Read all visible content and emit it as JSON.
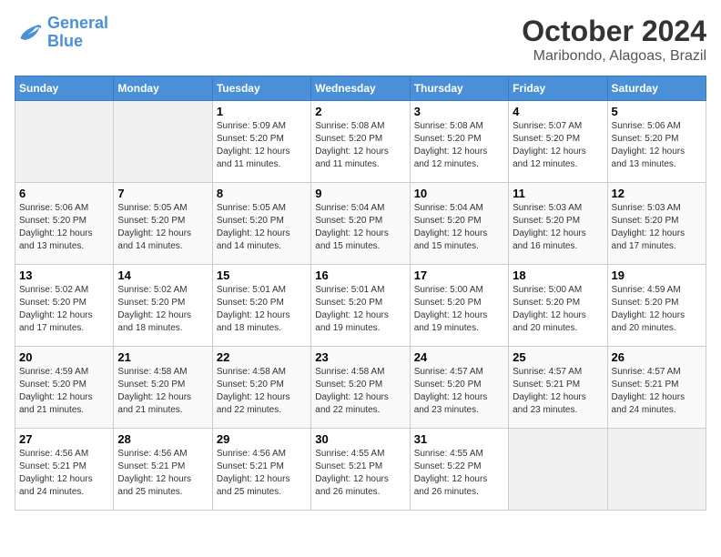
{
  "logo": {
    "line1": "General",
    "line2": "Blue"
  },
  "title": "October 2024",
  "subtitle": "Maribondo, Alagoas, Brazil",
  "headers": [
    "Sunday",
    "Monday",
    "Tuesday",
    "Wednesday",
    "Thursday",
    "Friday",
    "Saturday"
  ],
  "weeks": [
    [
      {
        "num": "",
        "sunrise": "",
        "sunset": "",
        "daylight": ""
      },
      {
        "num": "",
        "sunrise": "",
        "sunset": "",
        "daylight": ""
      },
      {
        "num": "1",
        "sunrise": "Sunrise: 5:09 AM",
        "sunset": "Sunset: 5:20 PM",
        "daylight": "Daylight: 12 hours and 11 minutes."
      },
      {
        "num": "2",
        "sunrise": "Sunrise: 5:08 AM",
        "sunset": "Sunset: 5:20 PM",
        "daylight": "Daylight: 12 hours and 11 minutes."
      },
      {
        "num": "3",
        "sunrise": "Sunrise: 5:08 AM",
        "sunset": "Sunset: 5:20 PM",
        "daylight": "Daylight: 12 hours and 12 minutes."
      },
      {
        "num": "4",
        "sunrise": "Sunrise: 5:07 AM",
        "sunset": "Sunset: 5:20 PM",
        "daylight": "Daylight: 12 hours and 12 minutes."
      },
      {
        "num": "5",
        "sunrise": "Sunrise: 5:06 AM",
        "sunset": "Sunset: 5:20 PM",
        "daylight": "Daylight: 12 hours and 13 minutes."
      }
    ],
    [
      {
        "num": "6",
        "sunrise": "Sunrise: 5:06 AM",
        "sunset": "Sunset: 5:20 PM",
        "daylight": "Daylight: 12 hours and 13 minutes."
      },
      {
        "num": "7",
        "sunrise": "Sunrise: 5:05 AM",
        "sunset": "Sunset: 5:20 PM",
        "daylight": "Daylight: 12 hours and 14 minutes."
      },
      {
        "num": "8",
        "sunrise": "Sunrise: 5:05 AM",
        "sunset": "Sunset: 5:20 PM",
        "daylight": "Daylight: 12 hours and 14 minutes."
      },
      {
        "num": "9",
        "sunrise": "Sunrise: 5:04 AM",
        "sunset": "Sunset: 5:20 PM",
        "daylight": "Daylight: 12 hours and 15 minutes."
      },
      {
        "num": "10",
        "sunrise": "Sunrise: 5:04 AM",
        "sunset": "Sunset: 5:20 PM",
        "daylight": "Daylight: 12 hours and 15 minutes."
      },
      {
        "num": "11",
        "sunrise": "Sunrise: 5:03 AM",
        "sunset": "Sunset: 5:20 PM",
        "daylight": "Daylight: 12 hours and 16 minutes."
      },
      {
        "num": "12",
        "sunrise": "Sunrise: 5:03 AM",
        "sunset": "Sunset: 5:20 PM",
        "daylight": "Daylight: 12 hours and 17 minutes."
      }
    ],
    [
      {
        "num": "13",
        "sunrise": "Sunrise: 5:02 AM",
        "sunset": "Sunset: 5:20 PM",
        "daylight": "Daylight: 12 hours and 17 minutes."
      },
      {
        "num": "14",
        "sunrise": "Sunrise: 5:02 AM",
        "sunset": "Sunset: 5:20 PM",
        "daylight": "Daylight: 12 hours and 18 minutes."
      },
      {
        "num": "15",
        "sunrise": "Sunrise: 5:01 AM",
        "sunset": "Sunset: 5:20 PM",
        "daylight": "Daylight: 12 hours and 18 minutes."
      },
      {
        "num": "16",
        "sunrise": "Sunrise: 5:01 AM",
        "sunset": "Sunset: 5:20 PM",
        "daylight": "Daylight: 12 hours and 19 minutes."
      },
      {
        "num": "17",
        "sunrise": "Sunrise: 5:00 AM",
        "sunset": "Sunset: 5:20 PM",
        "daylight": "Daylight: 12 hours and 19 minutes."
      },
      {
        "num": "18",
        "sunrise": "Sunrise: 5:00 AM",
        "sunset": "Sunset: 5:20 PM",
        "daylight": "Daylight: 12 hours and 20 minutes."
      },
      {
        "num": "19",
        "sunrise": "Sunrise: 4:59 AM",
        "sunset": "Sunset: 5:20 PM",
        "daylight": "Daylight: 12 hours and 20 minutes."
      }
    ],
    [
      {
        "num": "20",
        "sunrise": "Sunrise: 4:59 AM",
        "sunset": "Sunset: 5:20 PM",
        "daylight": "Daylight: 12 hours and 21 minutes."
      },
      {
        "num": "21",
        "sunrise": "Sunrise: 4:58 AM",
        "sunset": "Sunset: 5:20 PM",
        "daylight": "Daylight: 12 hours and 21 minutes."
      },
      {
        "num": "22",
        "sunrise": "Sunrise: 4:58 AM",
        "sunset": "Sunset: 5:20 PM",
        "daylight": "Daylight: 12 hours and 22 minutes."
      },
      {
        "num": "23",
        "sunrise": "Sunrise: 4:58 AM",
        "sunset": "Sunset: 5:20 PM",
        "daylight": "Daylight: 12 hours and 22 minutes."
      },
      {
        "num": "24",
        "sunrise": "Sunrise: 4:57 AM",
        "sunset": "Sunset: 5:20 PM",
        "daylight": "Daylight: 12 hours and 23 minutes."
      },
      {
        "num": "25",
        "sunrise": "Sunrise: 4:57 AM",
        "sunset": "Sunset: 5:21 PM",
        "daylight": "Daylight: 12 hours and 23 minutes."
      },
      {
        "num": "26",
        "sunrise": "Sunrise: 4:57 AM",
        "sunset": "Sunset: 5:21 PM",
        "daylight": "Daylight: 12 hours and 24 minutes."
      }
    ],
    [
      {
        "num": "27",
        "sunrise": "Sunrise: 4:56 AM",
        "sunset": "Sunset: 5:21 PM",
        "daylight": "Daylight: 12 hours and 24 minutes."
      },
      {
        "num": "28",
        "sunrise": "Sunrise: 4:56 AM",
        "sunset": "Sunset: 5:21 PM",
        "daylight": "Daylight: 12 hours and 25 minutes."
      },
      {
        "num": "29",
        "sunrise": "Sunrise: 4:56 AM",
        "sunset": "Sunset: 5:21 PM",
        "daylight": "Daylight: 12 hours and 25 minutes."
      },
      {
        "num": "30",
        "sunrise": "Sunrise: 4:55 AM",
        "sunset": "Sunset: 5:21 PM",
        "daylight": "Daylight: 12 hours and 26 minutes."
      },
      {
        "num": "31",
        "sunrise": "Sunrise: 4:55 AM",
        "sunset": "Sunset: 5:22 PM",
        "daylight": "Daylight: 12 hours and 26 minutes."
      },
      {
        "num": "",
        "sunrise": "",
        "sunset": "",
        "daylight": ""
      },
      {
        "num": "",
        "sunrise": "",
        "sunset": "",
        "daylight": ""
      }
    ]
  ]
}
